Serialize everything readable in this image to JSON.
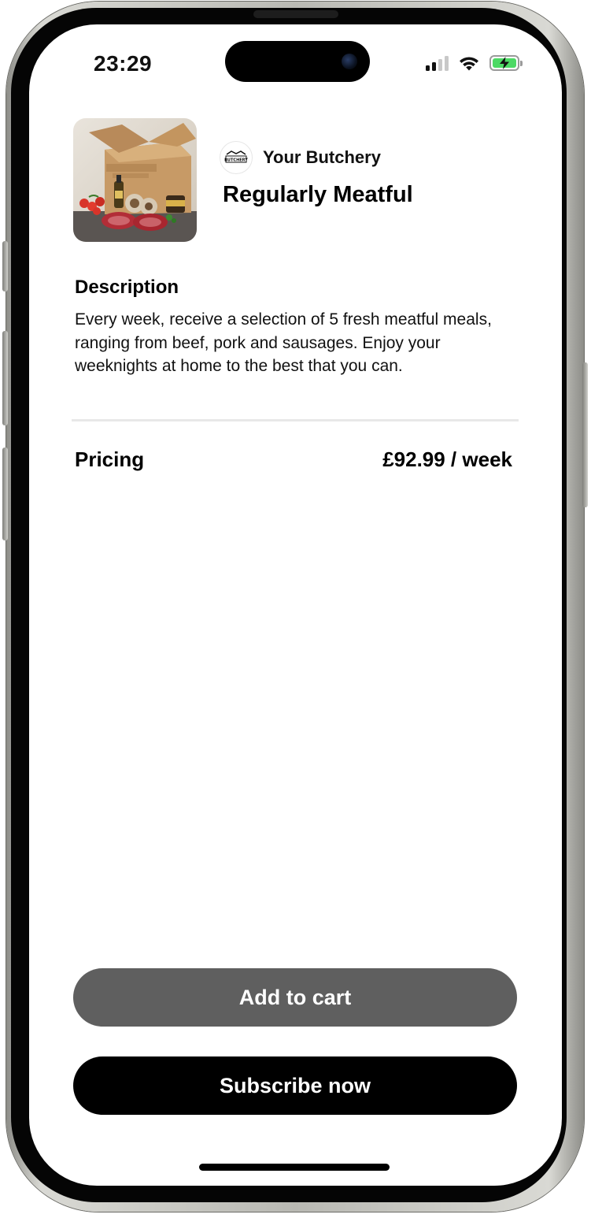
{
  "status_bar": {
    "time": "23:29",
    "icons": [
      "cellular-signal-icon",
      "wifi-icon",
      "battery-charging-icon"
    ],
    "battery_color": "#4cd964"
  },
  "product": {
    "image_alt": "Meat box with steaks, mushrooms, tomatoes and condiments",
    "brand_name": "Your Butchery",
    "brand_logo_text": "BUTCHERY",
    "title": "Regularly Meatful"
  },
  "description": {
    "heading": "Description",
    "body": "Every week, receive a selection of 5 fresh meatful meals, ranging from beef, pork and sausages. Enjoy your weeknights at home to the best that you can."
  },
  "pricing": {
    "label": "Pricing",
    "value": "£92.99 / week"
  },
  "actions": {
    "add_to_cart": "Add to cart",
    "subscribe": "Subscribe now"
  },
  "colors": {
    "add_to_cart_bg": "#5f5f5f",
    "subscribe_bg": "#000000",
    "divider": "#e8e8e8"
  }
}
